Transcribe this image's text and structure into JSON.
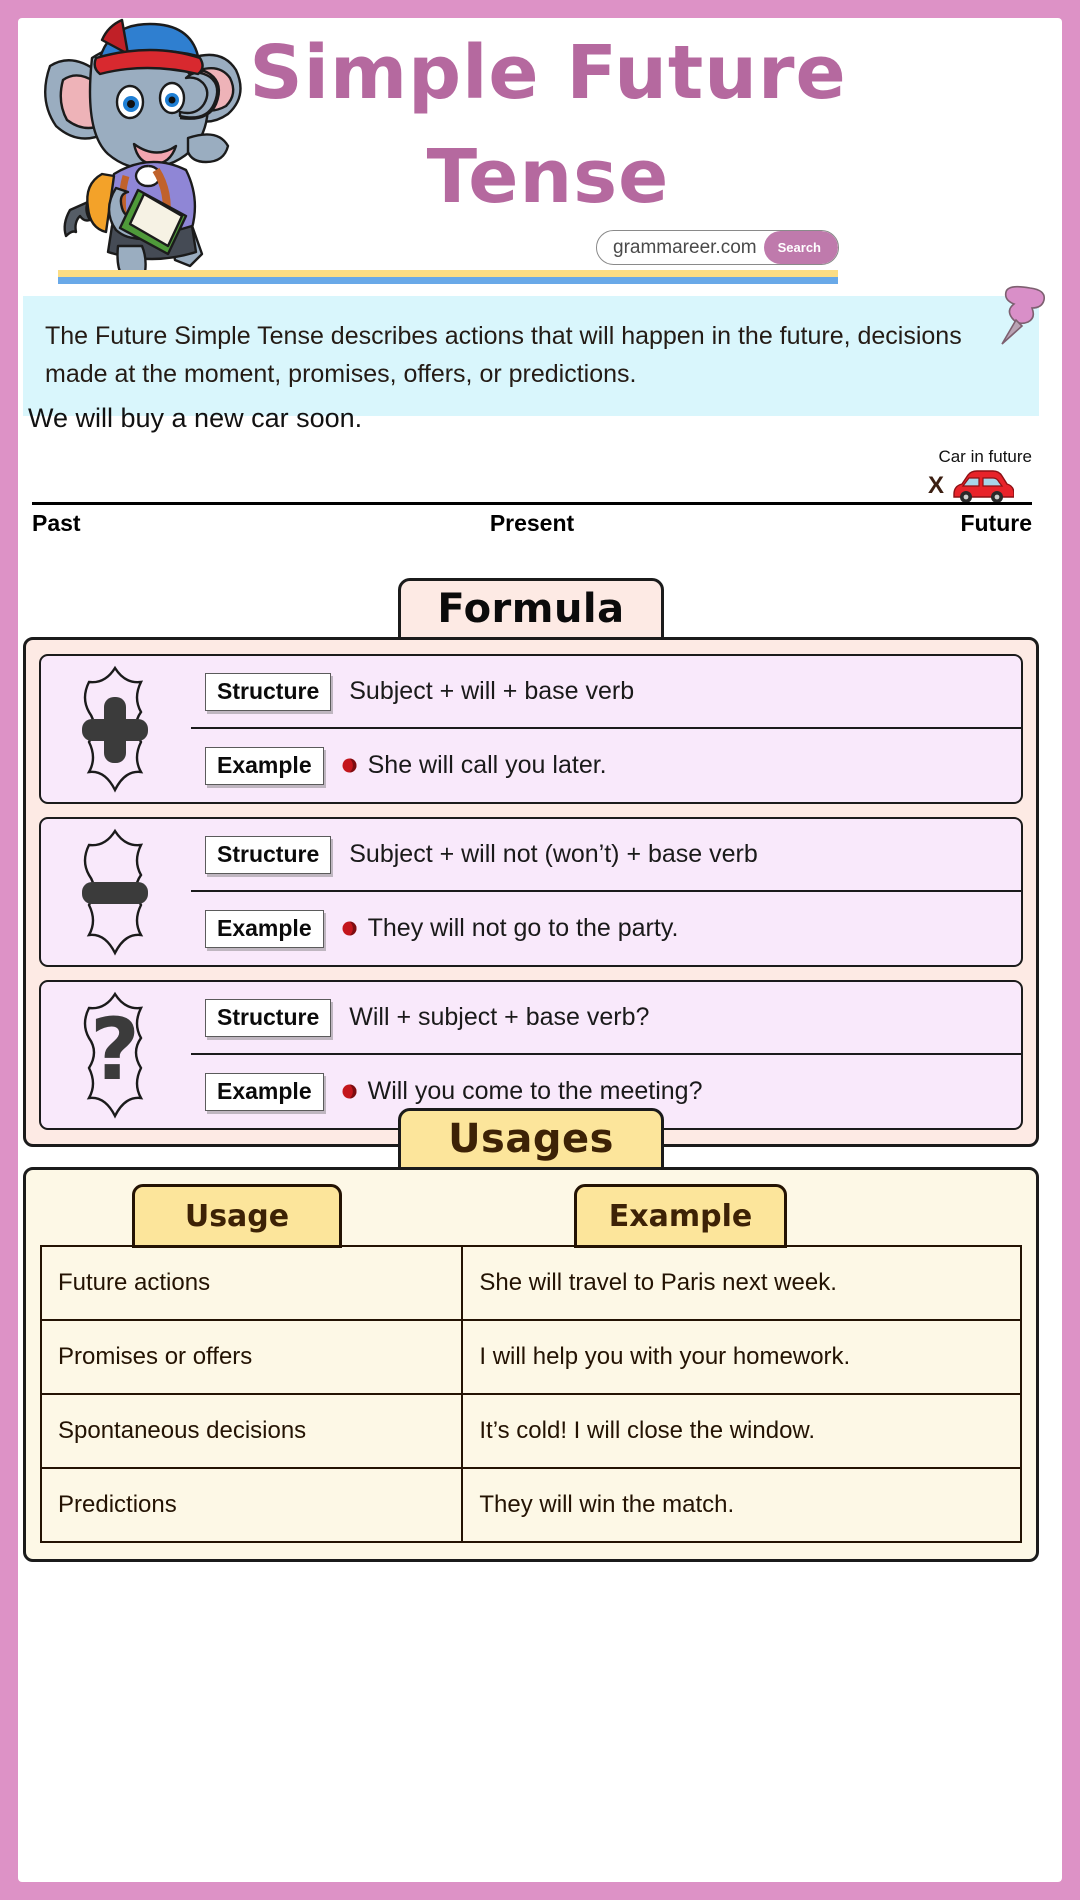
{
  "header": {
    "title": "Simple Future Tense",
    "search": {
      "url": "grammareer.com",
      "button_label": "Search"
    },
    "mascot_alt": "elephant-mascot",
    "colors": {
      "title": "#b5699f",
      "frame": "#dd92c6",
      "bar_yellow": "#fcdd84",
      "bar_blue": "#69a9e8"
    }
  },
  "intro": {
    "text": "The Future Simple Tense describes actions that will happen in the future, decisions made at the moment, promises, offers, or predictions.",
    "background": "#d9f6fc"
  },
  "timeline": {
    "sentence": "We will buy a new car soon.",
    "labels": {
      "past": "Past",
      "present": "Present",
      "future": "Future"
    },
    "marker": "X",
    "caption": "Car in future",
    "car_color": "#e8232a"
  },
  "formula": {
    "tab_label": "Formula",
    "rows": [
      {
        "badge": "plus-icon",
        "structure_label": "Structure",
        "structure_value": "Subject + will + base verb",
        "example_label": "Example",
        "example_value": "She will call you later."
      },
      {
        "badge": "minus-icon",
        "structure_label": "Structure",
        "structure_value": "Subject + will not (won’t) + base verb",
        "example_label": "Example",
        "example_value": "They will not go to the party."
      },
      {
        "badge": "question-icon",
        "structure_label": "Structure",
        "structure_value": "Will + subject + base verb?",
        "example_label": "Example",
        "example_value": "Will you come to the meeting?"
      }
    ]
  },
  "usages": {
    "tab_label": "Usages",
    "columns": [
      "Usage",
      "Example"
    ],
    "rows": [
      {
        "usage": "Future actions",
        "example": "She will travel to Paris next week."
      },
      {
        "usage": "Promises or offers",
        "example": "I will help you with your homework."
      },
      {
        "usage": "Spontaneous decisions",
        "example": "It’s cold! I will close the window."
      },
      {
        "usage": "Predictions",
        "example": "They will win the match."
      }
    ]
  }
}
